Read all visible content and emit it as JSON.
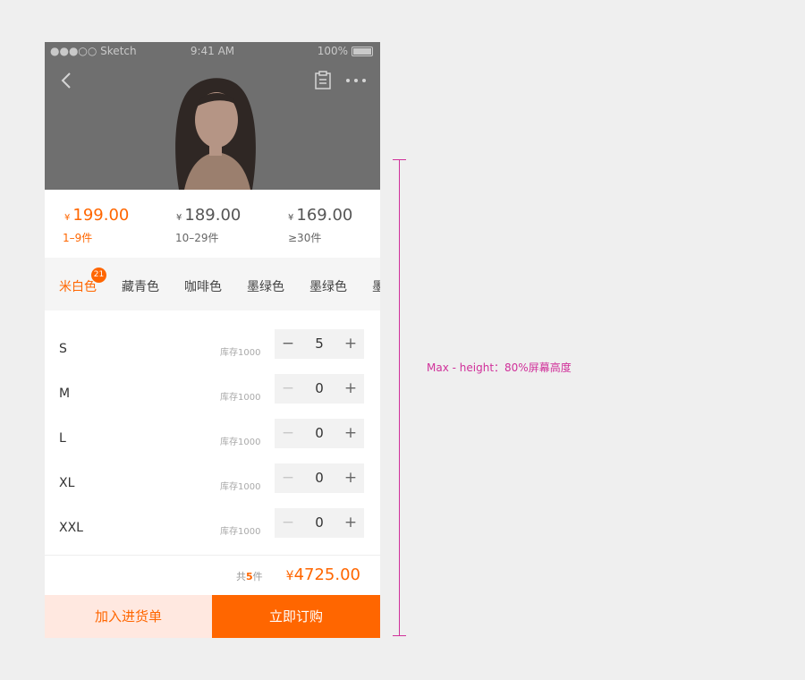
{
  "status_bar": {
    "signal": "●●●○○ Sketch",
    "time": "9:41 AM",
    "battery": "100%"
  },
  "header": {
    "back_icon": "chevron-left-icon",
    "clipboard_icon": "clipboard-icon",
    "more_icon": "more-dots-icon"
  },
  "price_tiers": [
    {
      "currency": "¥",
      "price": "199.00",
      "range": "1–9件",
      "active": true
    },
    {
      "currency": "¥",
      "price": "189.00",
      "range": "10–29件",
      "active": false
    },
    {
      "currency": "¥",
      "price": "169.00",
      "range": "≥30件",
      "active": false
    }
  ],
  "colors": {
    "tabs": [
      "米白色",
      "藏青色",
      "咖啡色",
      "墨绿色",
      "墨绿色",
      "墨"
    ],
    "selected": "米白色",
    "badge": "21"
  },
  "sizes": [
    {
      "label": "S",
      "stock": "库存1000",
      "qty": "5",
      "minus": "−",
      "plus": "+"
    },
    {
      "label": "M",
      "stock": "库存1000",
      "qty": "0",
      "minus": "−",
      "plus": "+"
    },
    {
      "label": "L",
      "stock": "库存1000",
      "qty": "0",
      "minus": "−",
      "plus": "+"
    },
    {
      "label": "XL",
      "stock": "库存1000",
      "qty": "0",
      "minus": "−",
      "plus": "+"
    },
    {
      "label": "XXL",
      "stock": "库存1000",
      "qty": "0",
      "minus": "−",
      "plus": "+"
    }
  ],
  "total": {
    "prefix": "共",
    "count": "5",
    "suffix": "件",
    "currency": "¥",
    "amount": "4725.00"
  },
  "actions": {
    "add_to_cart": "加入进货单",
    "buy_now": "立即订购"
  },
  "annotation": {
    "text": "Max - height：80%屏幕高度"
  },
  "theme": {
    "accent": "#ff6600",
    "annotation_color": "#d0309a",
    "background": "#efefef"
  }
}
